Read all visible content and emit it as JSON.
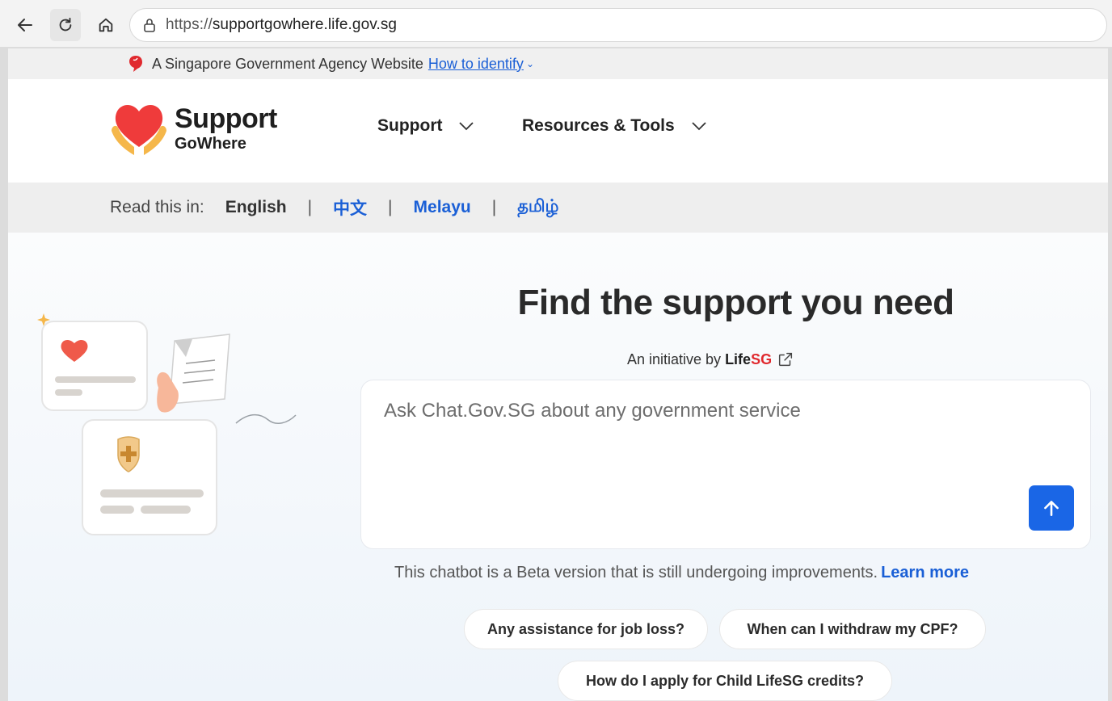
{
  "browser": {
    "url_prefix": "https://",
    "url_host": "supportgowhere.life.gov.sg",
    "icons": [
      "back-arrow-icon",
      "reload-icon",
      "home-icon",
      "lock-icon"
    ]
  },
  "gov_banner": {
    "text": "A Singapore Government Agency Website",
    "identify_link": "How to identify"
  },
  "header": {
    "logo_line1": "Support",
    "logo_line2": "GoWhere",
    "nav": [
      {
        "label": "Support"
      },
      {
        "label": "Resources & Tools"
      }
    ]
  },
  "language_bar": {
    "label": "Read this in:",
    "languages": [
      "English",
      "中文",
      "Melayu",
      "தமிழ்"
    ],
    "separator": "|"
  },
  "hero": {
    "title": "Find the support you need",
    "initiative_prefix": "An initiative by",
    "initiative_brand_a": "Life",
    "initiative_brand_b": "SG",
    "chat_placeholder": "Ask Chat.Gov.SG about any government service",
    "beta_note": "This chatbot is a Beta version that is still undergoing improvements.",
    "learn_more": "Learn more",
    "suggestions": [
      "Any assistance for job loss?",
      "When can I withdraw my CPF?",
      "How do I apply for Child LifeSG credits?"
    ]
  },
  "colors": {
    "accent_blue": "#1a66e6",
    "link_blue": "#1a5fd6",
    "brand_red": "#e0292e",
    "heart_red": "#ef3b3b",
    "hands_orange": "#f5b74a"
  }
}
